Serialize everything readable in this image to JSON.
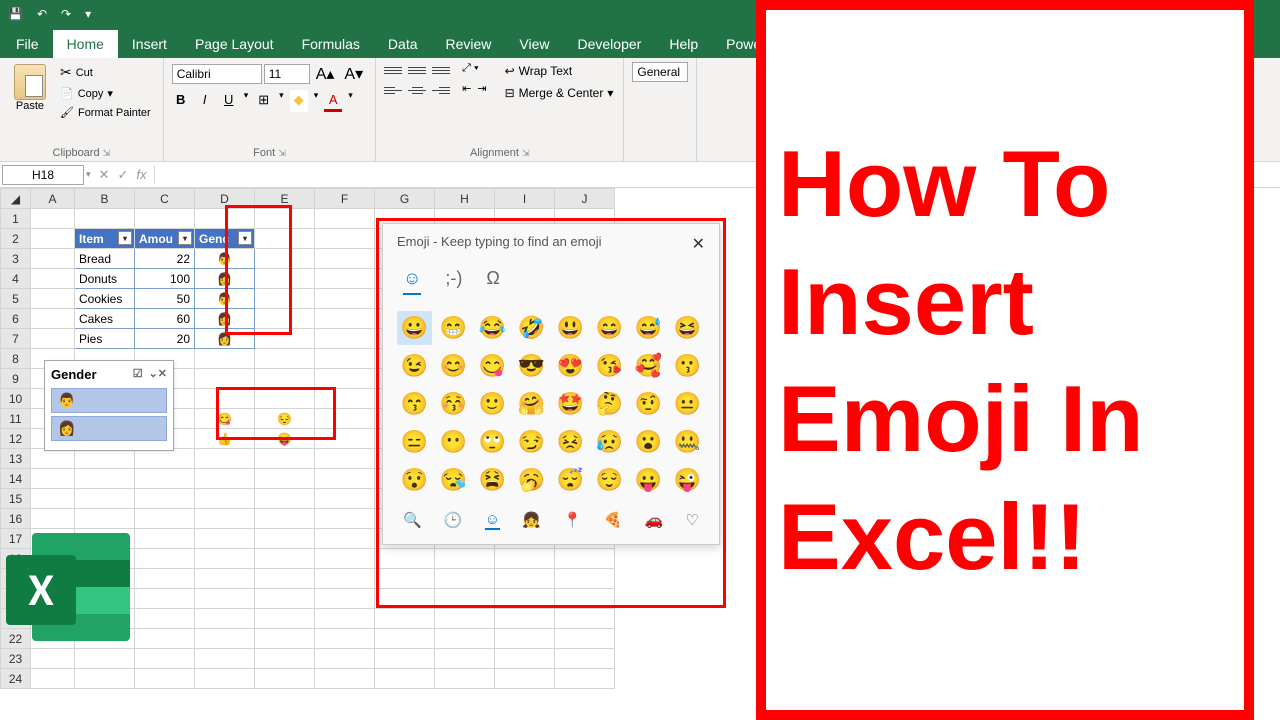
{
  "titlebar": {
    "save_icon": "💾",
    "undo": "↶",
    "redo": "↷"
  },
  "tabs": [
    "File",
    "Home",
    "Insert",
    "Page Layout",
    "Formulas",
    "Data",
    "Review",
    "View",
    "Developer",
    "Help",
    "Power Pivot"
  ],
  "active_tab": "Home",
  "ribbon": {
    "clipboard": {
      "label": "Clipboard",
      "paste": "Paste",
      "cut": "Cut",
      "copy": "Copy",
      "format_painter": "Format Painter"
    },
    "font": {
      "label": "Font",
      "name": "Calibri",
      "size": "11",
      "increase": "A▴",
      "decrease": "A▾",
      "bold": "B",
      "italic": "I",
      "underline": "U",
      "border": "⊞",
      "fill": "◆",
      "color": "A"
    },
    "alignment": {
      "label": "Alignment",
      "wrap": "Wrap Text",
      "merge": "Merge & Center"
    },
    "number_format": "General"
  },
  "namebox": "H18",
  "columns": [
    "A",
    "B",
    "C",
    "D",
    "E",
    "F",
    "G",
    "H",
    "I",
    "J"
  ],
  "rows": 24,
  "table": {
    "headers": [
      "Item",
      "Amou",
      "Genc"
    ],
    "data": [
      {
        "item": "Bread",
        "amount": "22",
        "gender": "👨"
      },
      {
        "item": "Donuts",
        "amount": "100",
        "gender": "👩"
      },
      {
        "item": "Cookies",
        "amount": "50",
        "gender": "👨"
      },
      {
        "item": "Cakes",
        "amount": "60",
        "gender": "👩"
      },
      {
        "item": "Pies",
        "amount": "20",
        "gender": "👩"
      }
    ]
  },
  "mini_emojis": {
    "r11c4": "😋",
    "r11c5": "😔",
    "r12c4": "👍",
    "r12c5": "😝"
  },
  "slicer": {
    "title": "Gender",
    "items": [
      "👨",
      "👩"
    ]
  },
  "emoji_picker": {
    "title": "Emoji - Keep typing to find an emoji",
    "tabs": [
      "☺",
      ";-)",
      "Ω"
    ],
    "grid": [
      "😀",
      "😁",
      "😂",
      "🤣",
      "😃",
      "😄",
      "😅",
      "😆",
      "😉",
      "😊",
      "😋",
      "😎",
      "😍",
      "😘",
      "🥰",
      "😗",
      "😙",
      "😚",
      "🙂",
      "🤗",
      "🤩",
      "🤔",
      "🤨",
      "😐",
      "😑",
      "😶",
      "🙄",
      "😏",
      "😣",
      "😥",
      "😮",
      "🤐",
      "😯",
      "😪",
      "😫",
      "🥱",
      "😴",
      "😌",
      "😛",
      "😜"
    ],
    "categories": [
      "🔍",
      "🕒",
      "☺",
      "👧",
      "📍",
      "🍕",
      "🚗",
      "♡"
    ]
  },
  "right_title": "How To Insert Emoji In Excel!!"
}
